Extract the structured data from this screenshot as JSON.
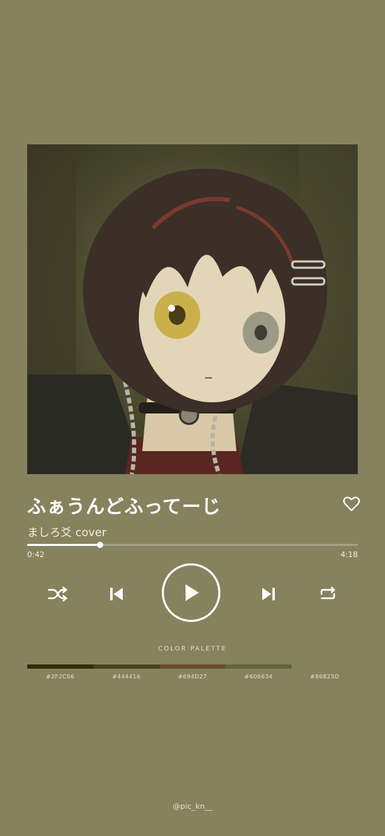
{
  "player": {
    "song_title": "ふぁうんどふってーじ",
    "artist": "ましろ爻 cover",
    "elapsed": "0:42",
    "duration": "4:18",
    "progress_fraction": 0.22,
    "icons": {
      "like": "heart-outline-icon",
      "shuffle": "shuffle-icon",
      "previous": "skip-previous-icon",
      "play": "play-icon",
      "next": "skip-next-icon",
      "repeat": "repeat-icon"
    }
  },
  "palette": {
    "label": "COLOR PALETTE",
    "colors": [
      {
        "hex": "#2F2C06",
        "label": "#2F2C06"
      },
      {
        "hex": "#444416",
        "label": "#444416"
      },
      {
        "hex": "#694D27",
        "label": "#694D27"
      },
      {
        "hex": "#606634",
        "label": "#606634"
      },
      {
        "hex": "#86825D",
        "label": "#86825D"
      }
    ]
  },
  "credit": "@pic_kn__"
}
